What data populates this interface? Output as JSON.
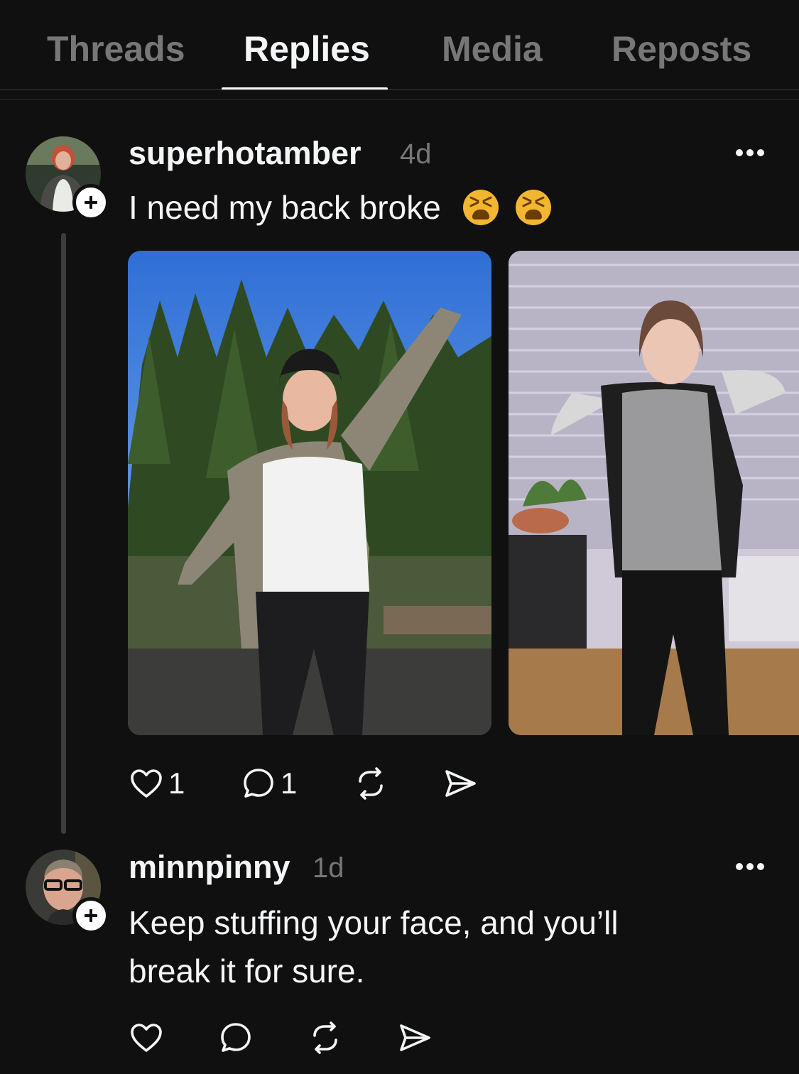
{
  "tabs": [
    {
      "label": "Threads",
      "active": false
    },
    {
      "label": "Replies",
      "active": true
    },
    {
      "label": "Media",
      "active": false
    },
    {
      "label": "Reposts",
      "active": false
    }
  ],
  "posts": [
    {
      "username": "superhotamber",
      "time": "4d",
      "text": "I need my back broke",
      "emojis": [
        "tired-face-emoji",
        "tired-face-emoji"
      ],
      "images": [
        "outdoor-photo",
        "indoor-photo"
      ],
      "likes": "1",
      "replies": "1"
    },
    {
      "username": "minnpinny",
      "time": "1d",
      "text_line1": "Keep stuffing your face, and you’ll",
      "text_line2": "break it for sure.",
      "likes": "",
      "replies": ""
    }
  ],
  "icons": {
    "like": "heart-icon",
    "reply": "comment-icon",
    "repost": "repost-icon",
    "share": "send-icon",
    "more": "more-dots-icon",
    "follow": "plus-icon"
  },
  "colors": {
    "background": "#101010",
    "text": "#f3f5f7",
    "muted": "#777777",
    "emoji": "#f2b631"
  }
}
